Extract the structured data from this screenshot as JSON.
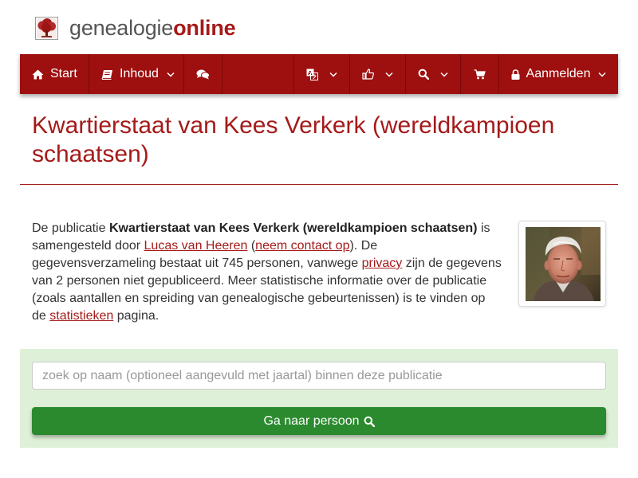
{
  "brand": {
    "prefix": "genealogie",
    "suffix": "online",
    "logo_icon": "tree-icon",
    "color": "#a51a1a"
  },
  "nav": {
    "start_label": "Start",
    "inhoud_label": "Inhoud",
    "login_label": "Aanmelden",
    "icons": {
      "start": "home-icon",
      "inhoud": "book-icon",
      "comments": "comments-icon",
      "language": "translate-icon",
      "social": "thumbs-up-icon",
      "search": "search-icon",
      "shop": "cart-icon",
      "login": "lock-icon"
    },
    "color": "#9e0f0f"
  },
  "page": {
    "title": "Kwartierstaat van Kees Verkerk (wereldkampioen schaatsen)"
  },
  "description": {
    "t1": "De publicatie ",
    "pub_title": "Kwartierstaat van Kees Verkerk (wereldkampioen schaatsen)",
    "t2": " is samengesteld door ",
    "author": "Lucas van Heeren",
    "t3": " (",
    "contact": "neem contact op",
    "t4": "). De gegevensverzameling bestaat uit 745 personen, vanwege ",
    "privacy": "privacy",
    "t5": " zijn de gegevens van 2 personen niet gepubliceerd. Meer statistische informatie over de publicatie (zoals aantallen en spreiding van genealogische gebeurtenissen) is te vinden op de ",
    "stats": "statistieken",
    "t6": " pagina."
  },
  "search": {
    "placeholder": "zoek op naam (optioneel aangevuld met jaartal) binnen deze publicatie",
    "value": "",
    "button_label": "Ga naar persoon",
    "panel_color": "#dff0d8",
    "button_color": "#2b8a2e"
  }
}
